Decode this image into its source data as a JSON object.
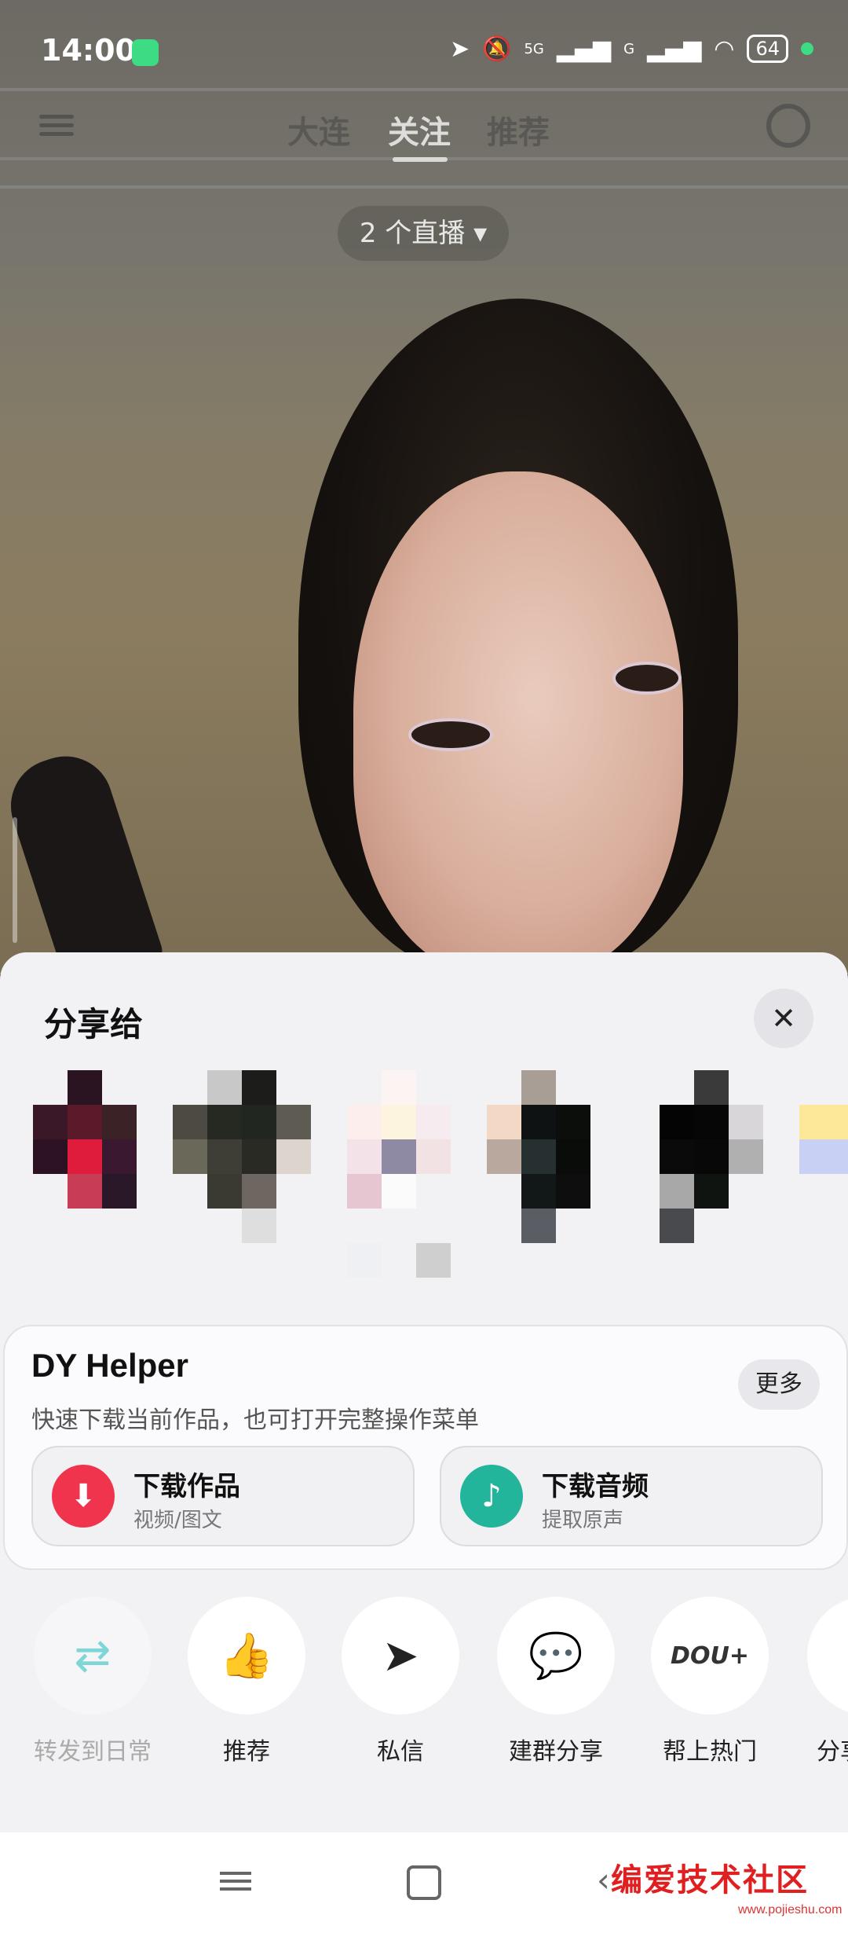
{
  "status": {
    "time": "14:00",
    "net1": "5G",
    "net2": "G",
    "battery": "64"
  },
  "nav": {
    "tabs": [
      "大连",
      "关注",
      "推荐"
    ],
    "active": "关注"
  },
  "live": {
    "label": "2 个直播 ▾"
  },
  "sheet": {
    "title": "分享给"
  },
  "helper": {
    "title": "DY Helper",
    "subtitle": "快速下载当前作品，也可打开完整操作菜单",
    "more_label": "更多",
    "actions": [
      {
        "title": "下载作品",
        "subtitle": "视频/图文",
        "icon_color": "#f0344e"
      },
      {
        "title": "下载音频",
        "subtitle": "提取原声",
        "icon_color": "#22b59c"
      }
    ]
  },
  "share_targets": [
    {
      "label": "转发到日常",
      "icon": "repost-icon",
      "color": "#7fd6d6"
    },
    {
      "label": "推荐",
      "icon": "thumbs-up-icon",
      "color": "#22b35a"
    },
    {
      "label": "私信",
      "icon": "send-icon",
      "color": "#222222"
    },
    {
      "label": "建群分享",
      "icon": "chat-group-icon",
      "color": "#222222"
    },
    {
      "label": "帮上热门",
      "icon": "dou-plus-icon",
      "color": "#333333"
    },
    {
      "label": "分享",
      "icon": "share-icon",
      "color": "#222222"
    }
  ],
  "watermark": {
    "text": "编爱技术社区",
    "url": "www.pojieshu.com"
  }
}
